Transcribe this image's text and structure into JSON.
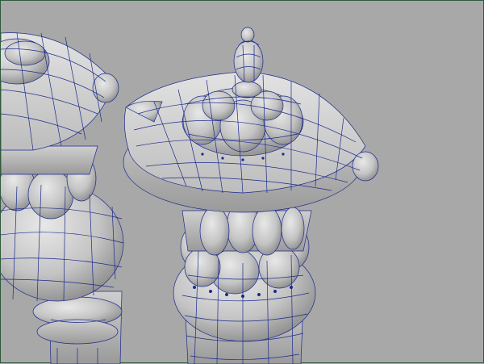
{
  "viewport": {
    "background": "#a8a8a8",
    "border_color": "#2f5a3a",
    "wire_color": "#1c2a8c",
    "mesh_color": "#d2d2d2",
    "mesh_shadow": "#8a8a8a"
  },
  "scene": {
    "objects": [
      {
        "name": "pagoda-lantern-left",
        "partially_visible": true
      },
      {
        "name": "pagoda-lantern-right",
        "partially_visible": false
      }
    ]
  }
}
